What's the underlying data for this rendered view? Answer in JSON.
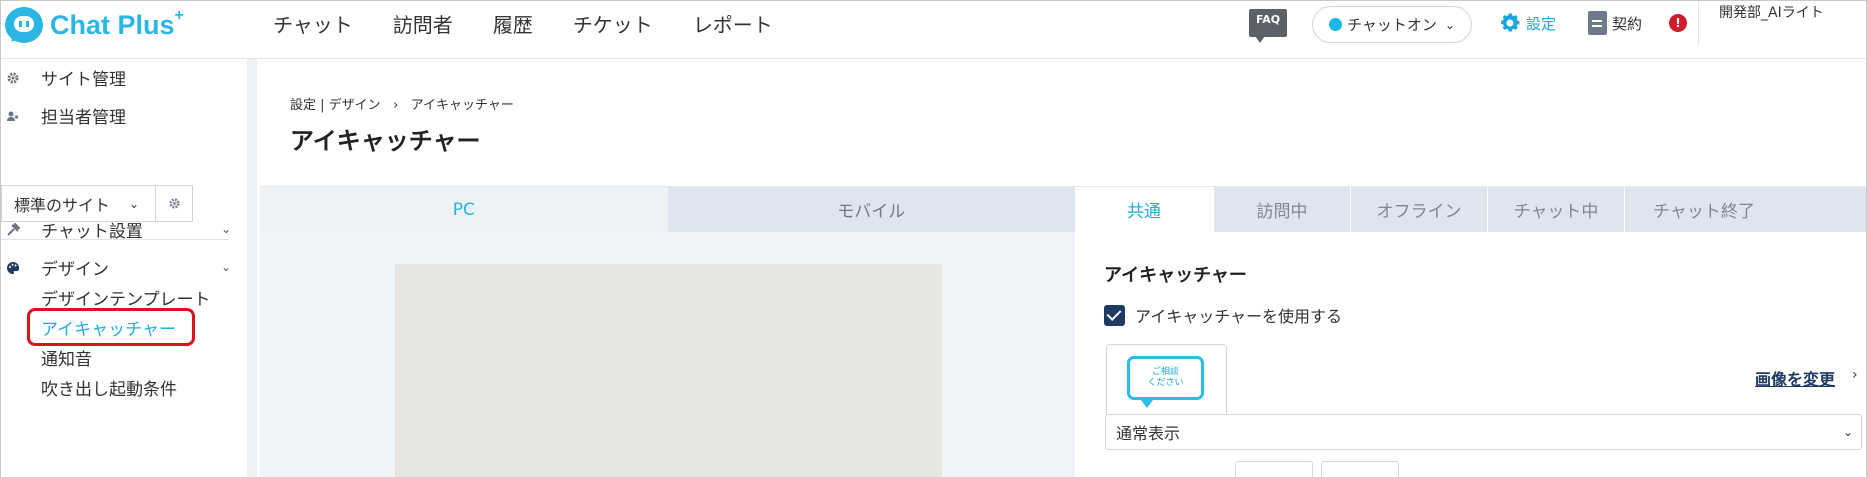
{
  "app": {
    "logo_text": "Chat Plus",
    "logo_plus": "+"
  },
  "header": {
    "nav": [
      "チャット",
      "訪問者",
      "履歴",
      "チケット",
      "レポート"
    ],
    "faq_label": "FAQ",
    "status_label": "チャットオン",
    "status_color": "#1ab6e8",
    "settings_label": "設定",
    "contract_label": "契約",
    "alert_label": "!",
    "user_name": "開発部_AIライト"
  },
  "sidebar": {
    "site_management": "サイト管理",
    "staff_management": "担当者管理",
    "site_select_value": "標準のサイト",
    "chat_install": "チャット設置",
    "design": "デザイン",
    "sub_items": [
      "デザインテンプレート",
      "アイキャッチャー",
      "通知音",
      "吹き出し起動条件"
    ],
    "active_sub_index": 1
  },
  "main": {
    "breadcrumb_settings": "設定",
    "breadcrumb_design": "デザイン",
    "breadcrumb_current": "アイキャッチャー",
    "page_title": "アイキャッチャー",
    "preview_tabs": [
      "PC",
      "モバイル"
    ],
    "settings_tabs": [
      "共通",
      "訪問中",
      "オフライン",
      "チャット中",
      "チャット終了"
    ],
    "panel_title": "アイキャッチャー",
    "use_eyecatcher_label": "アイキャッチャーを使用する",
    "use_eyecatcher_checked": true,
    "thumbnail_text_line1": "ご相談",
    "thumbnail_text_line2": "ください",
    "change_image_label": "画像を変更",
    "display_mode_value": "通常表示"
  },
  "colors": {
    "accent": "#1ab0e0",
    "navy": "#1f3a63",
    "highlight": "#e0101e"
  }
}
